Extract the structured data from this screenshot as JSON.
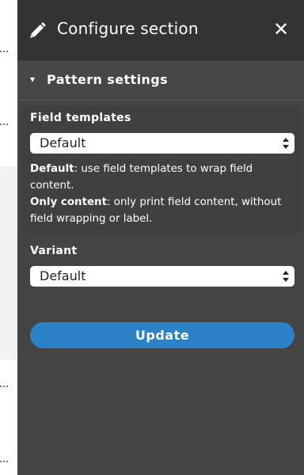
{
  "tray": {
    "title": "Configure section",
    "pencil_icon": "pencil-icon",
    "close_icon": "close-icon",
    "close_glyph": "✕"
  },
  "details": {
    "arrow": "▾",
    "summary": "Pattern settings"
  },
  "field_templates": {
    "label": "Field templates",
    "selected": "Default",
    "description": {
      "line1_strong": "Default",
      "line1_rest": ": use field templates to wrap field content.",
      "line2_strong": "Only content",
      "line2_rest": ": only print field content, without field wrapping or label."
    }
  },
  "variant": {
    "label": "Variant",
    "selected": "Default"
  },
  "actions": {
    "update_label": "Update"
  },
  "colors": {
    "tray_bg": "#444444",
    "header_bg": "#333333",
    "accent": "#2c82c9"
  }
}
